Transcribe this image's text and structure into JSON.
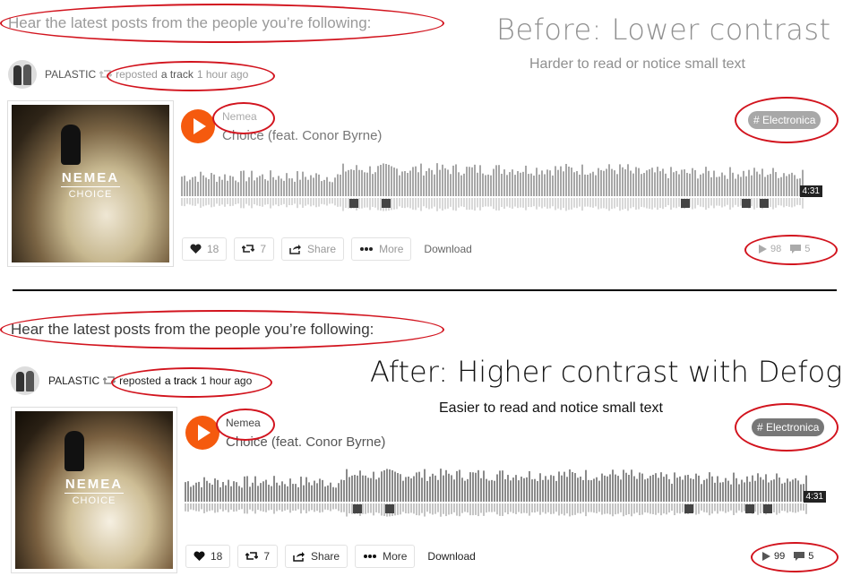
{
  "before": {
    "hear_text": "Hear the latest posts from the people you’re following:",
    "label_title": "Before: Lower contrast",
    "label_subtitle": "Harder to read or notice small text",
    "username": "PALASTIC",
    "reposted": "reposted",
    "a_track": "a track",
    "time_ago": "1 hour ago",
    "artwork_title": "NEMEA",
    "artwork_subtitle": "CHOICE",
    "artist": "Nemea",
    "track_title": "Choice (feat. Conor Byrne)",
    "tag": "# Electronica",
    "duration": "4:31",
    "likes": "18",
    "reposts": "7",
    "share_label": "Share",
    "more_label": "More",
    "download_label": "Download",
    "plays": "98",
    "comments": "5",
    "colors": {
      "text": "#9a9a9a",
      "accent": "#f55a0e"
    }
  },
  "after": {
    "hear_text": "Hear the latest posts from the people you’re following:",
    "label_title": "After: Higher contrast with Defog",
    "label_subtitle": "Easier to read and notice small text",
    "username": "PALASTIC",
    "reposted": "reposted",
    "a_track": "a track",
    "time_ago": "1 hour ago",
    "artwork_title": "NEMEA",
    "artwork_subtitle": "CHOICE",
    "artist": "Nemea",
    "track_title": "Choice (feat. Conor Byrne)",
    "tag": "# Electronica",
    "duration": "4:31",
    "likes": "18",
    "reposts": "7",
    "share_label": "Share",
    "more_label": "More",
    "download_label": "Download",
    "plays": "99",
    "comments": "5",
    "colors": {
      "text": "#222222",
      "accent": "#f55a0e",
      "highlight_ring": "#d2141e"
    }
  }
}
